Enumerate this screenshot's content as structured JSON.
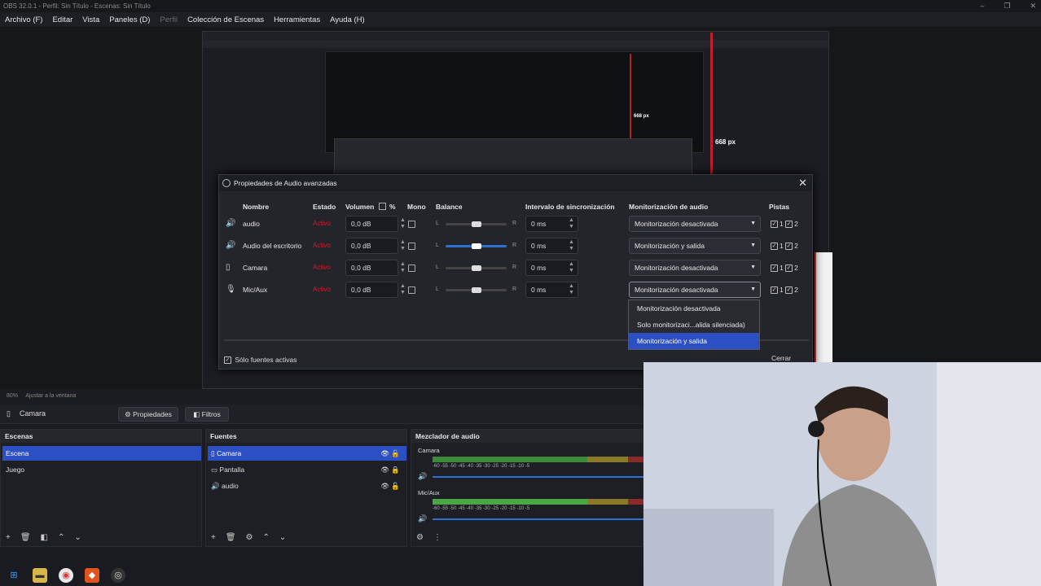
{
  "window": {
    "title": "OBS 32.0.1 - Perfil: Sin Título - Escenas: Sin Título",
    "controls": [
      "–",
      "❐",
      "✕"
    ]
  },
  "menu": {
    "items": [
      "Archivo (F)",
      "Editar",
      "Vista",
      "Paneles (D)",
      "Perfil",
      "Colección de Escenas",
      "Herramientas",
      "Ayuda (H)"
    ]
  },
  "preview": {
    "measure_a": "668 px",
    "measure_b": "668 px"
  },
  "dialog": {
    "title": "Propiedades de Audio avanzadas",
    "headers": {
      "name": "Nombre",
      "state": "Estado",
      "volume": "Volumen",
      "percent": "%",
      "mono": "Mono",
      "balance": "Balance",
      "sync": "Intervalo de sincronización",
      "monitor": "Monitorización de audio",
      "tracks": "Pistas"
    },
    "rows": [
      {
        "icon": "speaker-icon",
        "name": "audio",
        "state": "Activo",
        "volume": "0,0 dB",
        "sync": "0 ms",
        "monitor": "Monitorización desactivada",
        "balance": 0.5
      },
      {
        "icon": "speaker-icon",
        "name": "Audio del escritorio",
        "state": "Activo",
        "volume": "0,0 dB",
        "sync": "0 ms",
        "monitor": "Monitorización y salida",
        "balance": 0.5
      },
      {
        "icon": "file-icon",
        "name": "Camara",
        "state": "Activo",
        "volume": "0,0 dB",
        "sync": "0 ms",
        "monitor": "Monitorización desactivada",
        "balance": 0.5
      },
      {
        "icon": "mic-icon",
        "name": "Mic/Aux",
        "state": "Activo",
        "volume": "0,0 dB",
        "sync": "0 ms",
        "monitor": "Monitorización desactivada",
        "balance": 0.5
      }
    ],
    "balance_l": "L",
    "balance_r": "R",
    "track1": "1",
    "track2": "2",
    "only_active": "Sólo fuentes activas",
    "close": "Cerrar"
  },
  "dropdown": {
    "options": [
      "Monitorización desactivada",
      "Solo monitorizaci...alida silenciada)",
      "Monitorización y salida"
    ],
    "selected": 2
  },
  "zoombar": {
    "zoom": "80%",
    "fit": "Ajustar a la ventana"
  },
  "sourcebar": {
    "name": "Camara",
    "properties": "Propiedades",
    "filters": "Filtros"
  },
  "scenes": {
    "title": "Escenas",
    "items": [
      "Escena",
      "Juego"
    ]
  },
  "sources": {
    "title": "Fuentes",
    "items": [
      "Camara",
      "Pantalla",
      "audio"
    ]
  },
  "mixer": {
    "title": "Mezclador de audio",
    "channels": [
      {
        "name": "Camara"
      },
      {
        "name": "Mic/Aux"
      }
    ],
    "scale": [
      "-60",
      "-55",
      "-50",
      "-45",
      "-40",
      "-35",
      "-30",
      "-25",
      "-20",
      "-15",
      "-10",
      "-5"
    ]
  },
  "colors": {
    "accent": "#2d4fc4",
    "bg": "#1b1c21",
    "panel": "#1e1f24",
    "state_red": "#c02030"
  }
}
